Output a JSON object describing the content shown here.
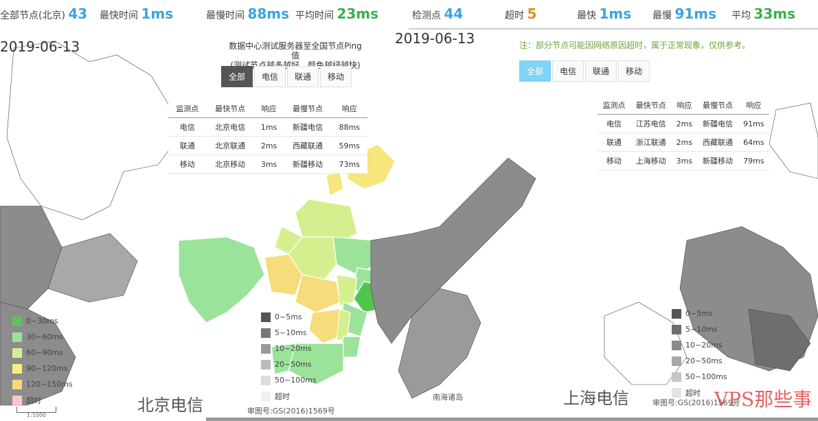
{
  "left_stats": {
    "label_total": "全部节点(北京)",
    "total_value": "43",
    "label_fastest": "最快时间",
    "fastest_value": "1ms",
    "label_slowest": "最慢时间",
    "slowest_value": "88ms",
    "label_avg": "平均时间",
    "avg_value": "23ms"
  },
  "right_stats": {
    "label_total": "检测点",
    "total_value": "44",
    "label_timeout": "超时",
    "timeout_value": "5",
    "label_fastest": "最快",
    "fastest_value": "1ms",
    "label_slowest": "最慢",
    "slowest_value": "91ms",
    "label_avg": "平均",
    "avg_value": "33ms"
  },
  "left_panel": {
    "title_line1": "数据中心测试服务器至全国节点Ping值",
    "title_line2": "(测试节点越多越好、颜色越绿越快)",
    "date": "2019-06-13",
    "tabs": [
      "全部",
      "电信",
      "联通",
      "移动"
    ],
    "active_tab": 0,
    "table": {
      "headers": [
        "监测点",
        "最快节点",
        "响应",
        "最慢节点",
        "响应"
      ],
      "rows": [
        [
          "电信",
          "北京电信",
          "1ms",
          "新疆电信",
          "88ms"
        ],
        [
          "联通",
          "北京联通",
          "2ms",
          "西藏联通",
          "59ms"
        ],
        [
          "移动",
          "北京移动",
          "3ms",
          "新疆移动",
          "73ms"
        ]
      ]
    }
  },
  "right_panel": {
    "date": "2019-06-13",
    "notice": "注：部分节点可能因网络原因超时，属于正常现象，仅供参考。",
    "tabs": [
      "全部",
      "电信",
      "联通",
      "移动"
    ],
    "active_tab": 0,
    "table": {
      "headers": [
        "监测点",
        "最快节点",
        "响应",
        "最慢节点",
        "响应"
      ],
      "rows": [
        [
          "电信",
          "江苏电信",
          "2ms",
          "新疆电信",
          "91ms"
        ],
        [
          "联通",
          "浙江联通",
          "2ms",
          "西藏联通",
          "64ms"
        ],
        [
          "移动",
          "上海移动",
          "3ms",
          "新疆移动",
          "79ms"
        ]
      ]
    }
  },
  "legend_left": {
    "items": [
      {
        "label": "0~30ms",
        "color": "#5ec15e"
      },
      {
        "label": "30~60ms",
        "color": "#9be39b"
      },
      {
        "label": "60~90ms",
        "color": "#d6ef8e"
      },
      {
        "label": "90~120ms",
        "color": "#f6ee80"
      },
      {
        "label": "120~150ms",
        "color": "#f8d97a"
      },
      {
        "label": "超时",
        "color": "#f8c8c8"
      }
    ]
  },
  "legend_mid": {
    "items": [
      {
        "label": "0~5ms",
        "color": "#555555"
      },
      {
        "label": "5~10ms",
        "color": "#777777"
      },
      {
        "label": "10~20ms",
        "color": "#999999"
      },
      {
        "label": "20~50ms",
        "color": "#bbbbbb"
      },
      {
        "label": "50~100ms",
        "color": "#dddddd"
      },
      {
        "label": "超时",
        "color": "#f0f0f0"
      }
    ]
  },
  "legend_right": {
    "items": [
      {
        "label": "0~5ms",
        "color": "#555555"
      },
      {
        "label": "5~10ms",
        "color": "#6e6e6e"
      },
      {
        "label": "10~20ms",
        "color": "#8a8a8a"
      },
      {
        "label": "20~50ms",
        "color": "#a8a8a8"
      },
      {
        "label": "50~100ms",
        "color": "#c6c6c6"
      },
      {
        "label": "超时",
        "color": "#e4e4e4"
      }
    ]
  },
  "map_labels": {
    "left_caption": "北京电信",
    "mid_caption": "南海诸岛",
    "right_caption": "上海电信",
    "footer_left": "审图号:GS(2016)1569号",
    "footer_right": "审图号:GS(2016)1569号",
    "scale": "1:1000",
    "watermark": "VPS那些事"
  },
  "colors": {
    "accent": "#3aa3e3",
    "green": "#34b24a",
    "orange": "#e88a1a",
    "map_gray": "#8c8c8c",
    "map_gray_dark": "#6e6e6e"
  }
}
